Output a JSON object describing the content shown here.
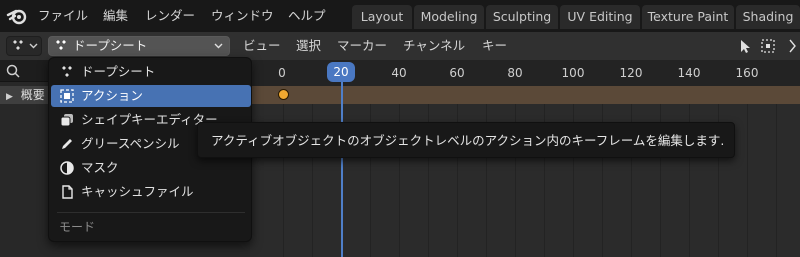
{
  "topbar": {
    "menus": [
      "ファイル",
      "編集",
      "レンダー",
      "ウィンドウ",
      "ヘルプ"
    ],
    "workspace_tabs": [
      "Layout",
      "Modeling",
      "Sculpting",
      "UV Editing",
      "Texture Paint",
      "Shading"
    ]
  },
  "header": {
    "editor_mode": "ドープシート",
    "menus": [
      "ビュー",
      "選択",
      "マーカー",
      "チャンネル",
      "キー"
    ]
  },
  "channels": {
    "summary_label": "概要"
  },
  "timeline": {
    "current_frame": "20",
    "ticks": [
      "0",
      "20",
      "40",
      "60",
      "80",
      "100",
      "120",
      "140",
      "160"
    ]
  },
  "dropdown": {
    "items": [
      {
        "label": "ドープシート",
        "icon": "dopesheet-icon",
        "active": false
      },
      {
        "label": "アクション",
        "icon": "action-icon",
        "active": true
      },
      {
        "label": "シェイプキーエディター",
        "icon": "shapekey-icon",
        "active": false
      },
      {
        "label": "グリースペンシル",
        "icon": "pencil-icon",
        "active": false
      },
      {
        "label": "マスク",
        "icon": "mask-icon",
        "active": false
      },
      {
        "label": "キャッシュファイル",
        "icon": "file-icon",
        "active": false
      }
    ],
    "footer_label": "モード"
  },
  "tooltip": {
    "text": "アクティブオブジェクトのオブジェクトレベルのアクション内のキーフレームを編集します."
  },
  "colors": {
    "accent": "#4772b3",
    "playhead": "#4f7fc9",
    "keyframe": "#f0a830",
    "summary": "#6b4a2b"
  }
}
